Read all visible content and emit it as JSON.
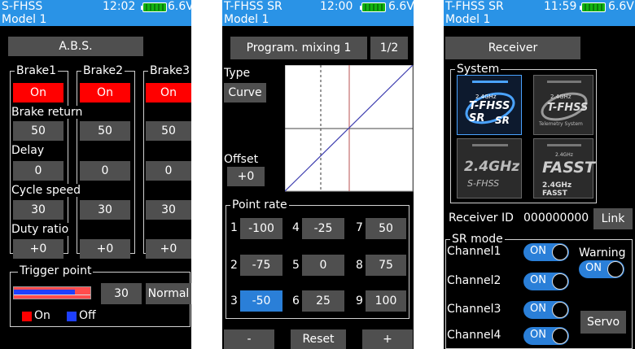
{
  "panels": [
    {
      "header": {
        "title": "S-FHSS",
        "model": "Model 1",
        "clock": "12:02",
        "voltage": "6.6V"
      },
      "menu_title": "A.B.S.",
      "brakes": [
        "Brake1",
        "Brake2",
        "Brake3"
      ],
      "brake_values": [
        "On",
        "On",
        "On"
      ],
      "rows": [
        {
          "label": "Brake return",
          "values": [
            "50",
            "50",
            "50"
          ]
        },
        {
          "label": "Delay",
          "values": [
            "0",
            "0",
            "0"
          ]
        },
        {
          "label": "Cycle speed",
          "values": [
            "30",
            "30",
            "30"
          ]
        },
        {
          "label": "Duty ratio",
          "values": [
            "+0",
            "+0",
            "+0"
          ]
        }
      ],
      "trigger_point": {
        "title": "Trigger point",
        "value": "30",
        "mode": "Normal",
        "bar_level": 0.8
      },
      "legend": {
        "on": "On",
        "off": "Off"
      }
    },
    {
      "header": {
        "title": "T-FHSS SR",
        "model": "Model 1",
        "clock": "12:00",
        "voltage": "6.6V"
      },
      "menu_title": "Program. mixing 1",
      "page": "1/2",
      "type_label": "Type",
      "type_value": "Curve",
      "offset_label": "Offset",
      "offset_value": "+0",
      "point_rate_title": "Point rate",
      "points": [
        {
          "n": "1",
          "v": "-100"
        },
        {
          "n": "4",
          "v": "-25"
        },
        {
          "n": "7",
          "v": "50"
        },
        {
          "n": "2",
          "v": "-75"
        },
        {
          "n": "5",
          "v": "0"
        },
        {
          "n": "8",
          "v": "75"
        },
        {
          "n": "3",
          "v": "-50",
          "selected": true
        },
        {
          "n": "6",
          "v": "25"
        },
        {
          "n": "9",
          "v": "100"
        }
      ],
      "buttons": {
        "minus": "-",
        "reset": "Reset",
        "plus": "+"
      }
    },
    {
      "header": {
        "title": "T-FHSS SR",
        "model": "Model 1",
        "clock": "11:59",
        "voltage": "6.6V"
      },
      "menu_title": "Receiver",
      "system_title": "System",
      "system_tiles": [
        {
          "name": "T-FHSS SR",
          "sub": "SR",
          "top": "2.4GHz",
          "selected": true
        },
        {
          "name": "T-FHSS",
          "sub": "Telemetry System",
          "top": "2.4GHz",
          "selected": false
        },
        {
          "name": "2.4GHz",
          "sub": "S-FHSS",
          "top": "",
          "selected": false
        },
        {
          "name": "FASST",
          "sub": "2.4GHz FASST",
          "top": "2.4GHz",
          "selected": false
        }
      ],
      "receiver_id_label": "Receiver ID",
      "receiver_id": "000000000",
      "link_label": "Link",
      "sr_mode_title": "SR mode",
      "channels": [
        {
          "label": "Channel1",
          "state": "ON"
        },
        {
          "label": "Channel2",
          "state": "ON"
        },
        {
          "label": "Channel3",
          "state": "ON"
        },
        {
          "label": "Channel4",
          "state": "ON"
        }
      ],
      "warning_label": "Warning",
      "warning_state": "ON",
      "servo_label": "Servo"
    }
  ],
  "colors": {
    "header": "#2a93e6",
    "active_red": "#ff0000",
    "selected_blue": "#2a7fd8",
    "button_grey": "#4f4f4f",
    "curve_line": "#3f3fb0",
    "center_line": "#b85050"
  }
}
